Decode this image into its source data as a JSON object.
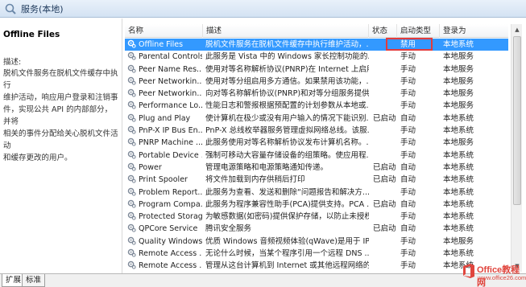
{
  "window": {
    "title": "服务(本地)"
  },
  "left_pane": {
    "service_name": "Offline Files",
    "description_label": "描述:",
    "description_lines": [
      "脱机文件服务在脱机文件缓存中执行",
      "维护活动，响应用户登录和注销事",
      "件，实现公共 API 的内部部分，并将",
      "相关的事件分配给关心脱机文件活动",
      "和缓存更改的用户。"
    ]
  },
  "columns": {
    "name": "名称",
    "description": "描述",
    "status": "状态",
    "startup_type": "启动类型",
    "logon_as": "登录为"
  },
  "services": [
    {
      "name": "Offline Files",
      "description": "脱机文件服务在脱机文件缓存中执行维护活动，...",
      "status": "",
      "startup": "禁用",
      "logon": "本地系统",
      "selected": true
    },
    {
      "name": "Parental Controls",
      "description": "此服务是 Vista 中的 Windows 家长控制功能的...",
      "status": "",
      "startup": "手动",
      "logon": "本地服务"
    },
    {
      "name": "Peer Name Res...",
      "description": "使用对等名称解析协议(PNRP)在 Internet 上启用...",
      "status": "",
      "startup": "手动",
      "logon": "本地服务"
    },
    {
      "name": "Peer Networkin...",
      "description": "使用对等分组启用多方通信。如果禁用该功能，...",
      "status": "",
      "startup": "手动",
      "logon": "本地服务"
    },
    {
      "name": "Peer Networkin...",
      "description": "向对等名称解析协议(PNRP)和对等分组服务提供...",
      "status": "",
      "startup": "手动",
      "logon": "本地服务"
    },
    {
      "name": "Performance Lo...",
      "description": "性能日志和警报根据预配置的计划参数从本地或...",
      "status": "",
      "startup": "手动",
      "logon": "本地服务"
    },
    {
      "name": "Plug and Play",
      "description": "使计算机在极少或没有用户输入的情况下能识别...",
      "status": "已启动",
      "startup": "自动",
      "logon": "本地系统"
    },
    {
      "name": "PnP-X IP Bus En...",
      "description": "PnP-X 总线枚举器服务管理虚拟网络总线。该服...",
      "status": "",
      "startup": "手动",
      "logon": "本地系统"
    },
    {
      "name": "PNRP Machine ...",
      "description": "此服务使用对等名称解析协议发布计算机名称。...",
      "status": "",
      "startup": "手动",
      "logon": "本地服务"
    },
    {
      "name": "Portable Device ...",
      "description": "强制可移动大容量存储设备的组策略。使应用程...",
      "status": "",
      "startup": "手动",
      "logon": "本地系统"
    },
    {
      "name": "Power",
      "description": "管理电源策略和电源策略通知传递。",
      "status": "已启动",
      "startup": "自动",
      "logon": "本地系统"
    },
    {
      "name": "Print Spooler",
      "description": "将文件加载到内存供稍后打印",
      "status": "已启动",
      "startup": "自动",
      "logon": "本地系统"
    },
    {
      "name": "Problem Report...",
      "description": "此服务为查看、发送和删除“问题报告和解决方...",
      "status": "",
      "startup": "手动",
      "logon": "本地系统"
    },
    {
      "name": "Program Compa...",
      "description": "此服务为程序兼容性助手(PCA)提供支持。PCA ...",
      "status": "已启动",
      "startup": "自动",
      "logon": "本地系统"
    },
    {
      "name": "Protected Storage",
      "description": "为敏感数据(如密码)提供保护存储，以防止未授权...",
      "status": "",
      "startup": "手动",
      "logon": "本地系统"
    },
    {
      "name": "QPCore Service",
      "description": "腾讯安全服务",
      "status": "已启动",
      "startup": "自动",
      "logon": "本地系统"
    },
    {
      "name": "Quality Windows...",
      "description": "优质 Windows 音频视频体验(qWave)是用于 IP ...",
      "status": "",
      "startup": "手动",
      "logon": "本地服务"
    },
    {
      "name": "Remote Access ...",
      "description": "无论什么时候，当某个程序引用一个远程 DNS ...",
      "status": "",
      "startup": "手动",
      "logon": "本地系统"
    },
    {
      "name": "Remote Access ...",
      "description": "管理从这台计算机到 Internet 或其他远程网络的...",
      "status": "",
      "startup": "手动",
      "logon": "本地系统"
    }
  ],
  "tabs": [
    {
      "label": "扩展",
      "active": true
    },
    {
      "label": "标准",
      "active": false
    }
  ],
  "watermark": {
    "brand": "Office教程网",
    "url": "www.office26.com"
  },
  "colors": {
    "selection": "#3399ff",
    "highlight_box": "#e23b3b",
    "watermark": "#e0453d"
  }
}
